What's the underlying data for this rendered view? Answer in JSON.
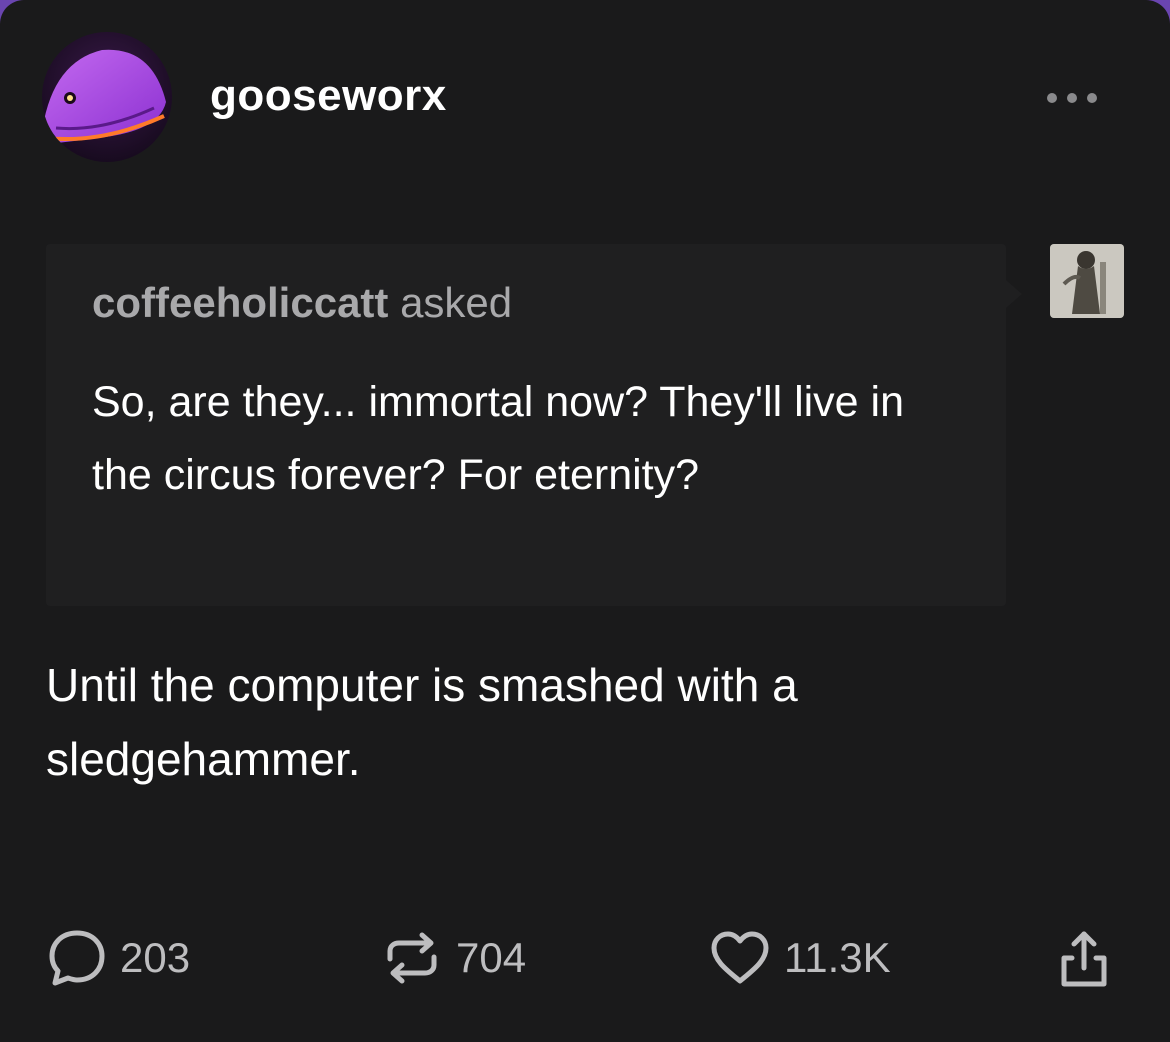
{
  "post": {
    "author": "gooseworx",
    "ask": {
      "asker": "coffeeholiccatt",
      "verb": "asked",
      "question": "So, are they... immortal now? They'll live in the circus forever? For eternity?"
    },
    "answer": "Until the computer is smashed with a sledgehammer."
  },
  "footer": {
    "comments": "203",
    "reblogs": "704",
    "likes": "11.3K"
  },
  "icons": {
    "more": "more-options-icon",
    "comment": "comment-bubble-icon",
    "reblog": "reblog-arrows-icon",
    "like": "heart-icon",
    "share": "share-upload-icon"
  },
  "colors": {
    "background": "#1a1a1b",
    "ask_background": "#1f1f20",
    "text": "#ffffff",
    "muted_text": "#a9a9ab",
    "accent_edge": "#6a45b0"
  }
}
